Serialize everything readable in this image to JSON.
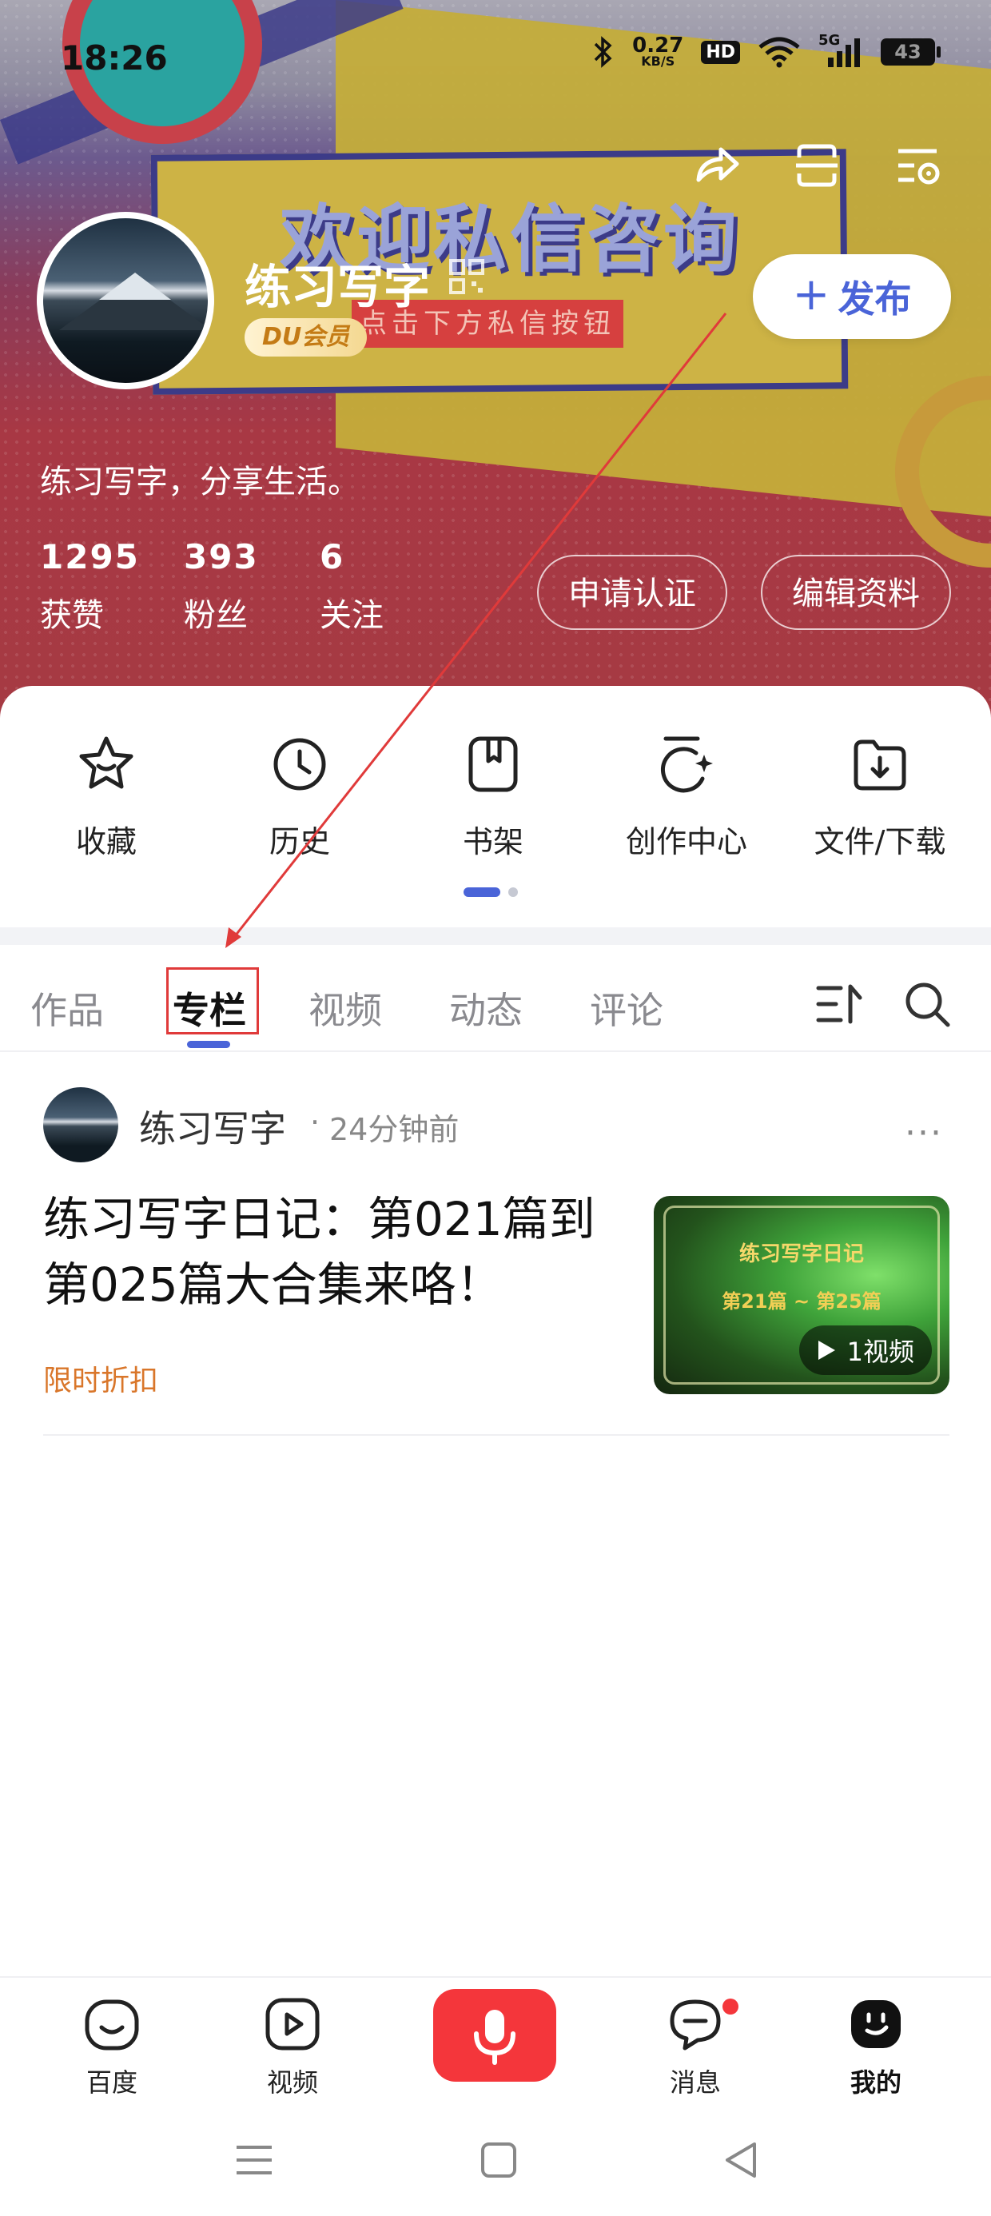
{
  "status_bar": {
    "time": "18:26",
    "net_speed_value": "0.27",
    "net_speed_unit": "KB/S",
    "hd_badge": "HD",
    "network": "5G",
    "battery": "43",
    "icons": [
      "bluetooth-icon",
      "hd-icon",
      "wifi-icon",
      "signal-icon",
      "battery-icon"
    ]
  },
  "banner": {
    "title": "欢迎私信咨询",
    "subtitle": "点击下方私信按钮"
  },
  "top_actions": [
    "share-icon",
    "scan-icon",
    "settings-icon"
  ],
  "profile": {
    "username": "练习写字",
    "vip_label": "DU会员",
    "bio": "练习写字，分享生活。",
    "publish_label": "发布",
    "publish_plus": "+",
    "stats": [
      {
        "value": "1295",
        "label": "获赞"
      },
      {
        "value": "393",
        "label": "粉丝"
      },
      {
        "value": "6",
        "label": "关注"
      }
    ],
    "verify_label": "申请认证",
    "edit_label": "编辑资料"
  },
  "quick_actions": [
    {
      "label": "收藏",
      "icon": "star-icon"
    },
    {
      "label": "历史",
      "icon": "clock-icon"
    },
    {
      "label": "书架",
      "icon": "bookshelf-icon"
    },
    {
      "label": "创作中心",
      "icon": "creation-icon"
    },
    {
      "label": "文件/下载",
      "icon": "download-icon"
    }
  ],
  "tabs": {
    "items": [
      "作品",
      "专栏",
      "视频",
      "动态",
      "评论"
    ],
    "active": "专栏"
  },
  "post": {
    "author": "练习写字",
    "separator": "·",
    "time": "24分钟前",
    "more": "···",
    "title": "练习写字日记：第021篇到第025篇大合集来咯！",
    "tag": "限时折扣",
    "thumb_title": "练习写字日记",
    "thumb_subtitle": "第21篇 ~ 第25篇",
    "thumb_video_count": "1视频"
  },
  "bottom_nav": [
    {
      "label": "百度",
      "icon": "baidu-icon"
    },
    {
      "label": "视频",
      "icon": "video-icon"
    },
    {
      "label": "",
      "icon": "mic-icon"
    },
    {
      "label": "消息",
      "icon": "message-icon"
    },
    {
      "label": "我的",
      "icon": "mine-icon"
    }
  ],
  "colors": {
    "accent": "#4a64d8",
    "mic": "#f4363b",
    "tag": "#d9762a",
    "annotation": "#e03a3a"
  }
}
